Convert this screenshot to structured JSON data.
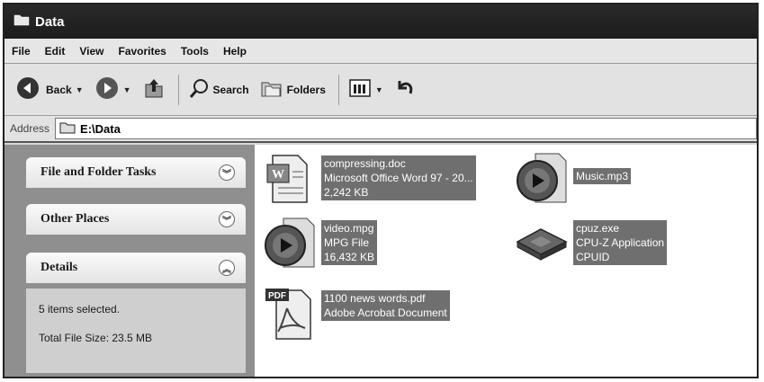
{
  "window": {
    "title": "Data"
  },
  "menu": [
    "File",
    "Edit",
    "View",
    "Favorites",
    "Tools",
    "Help"
  ],
  "toolbar": {
    "back_label": "Back",
    "search_label": "Search",
    "folders_label": "Folders"
  },
  "address": {
    "label": "Address",
    "path": "E:\\Data"
  },
  "taskpane": {
    "file_folder_tasks": "File and Folder Tasks",
    "other_places": "Other Places",
    "details": {
      "title": "Details",
      "items_selected": "5 items selected.",
      "total_size": "Total File Size: 23.5 MB"
    }
  },
  "files": [
    {
      "icon": "word-document-icon",
      "name": "compressing.doc",
      "type": "Microsoft Office Word 97 - 20...",
      "size": "2,242 KB"
    },
    {
      "icon": "media-file-icon",
      "name": "Music.mp3"
    },
    {
      "icon": "media-file-icon",
      "name": "video.mpg",
      "type": "MPG File",
      "size": "16,432 KB"
    },
    {
      "icon": "application-icon",
      "name": "cpuz.exe",
      "type": "CPU-Z Application",
      "size": "CPUID"
    },
    {
      "icon": "pdf-document-icon",
      "name": "1100 news words.pdf",
      "type": "Adobe Acrobat Document"
    }
  ]
}
